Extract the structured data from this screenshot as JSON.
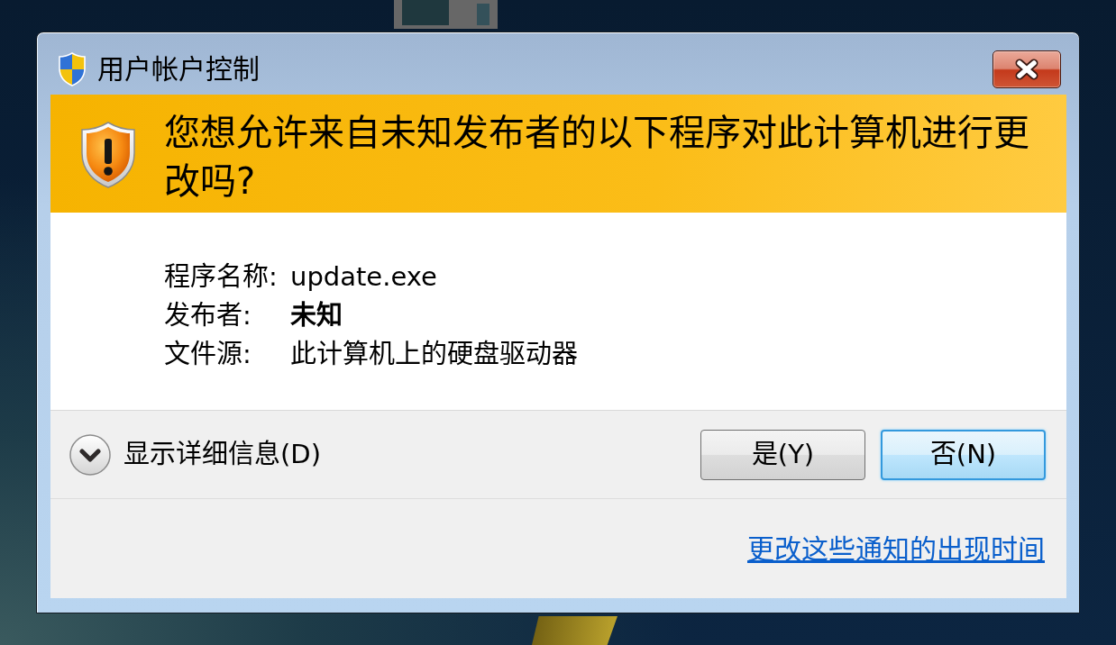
{
  "window": {
    "title": "用户帐户控制"
  },
  "header": {
    "question": "您想允许来自未知发布者的以下程序对此计算机进行更改吗?"
  },
  "details": [
    {
      "label": "程序名称:",
      "value": "update.exe",
      "bold": false
    },
    {
      "label": "发布者:",
      "value": "未知",
      "bold": true
    },
    {
      "label": "文件源:",
      "value": "此计算机上的硬盘驱动器",
      "bold": false
    }
  ],
  "details_toggle": {
    "label": "显示详细信息(D)",
    "expanded": false
  },
  "buttons": [
    {
      "label": "是(Y)",
      "focused": false
    },
    {
      "label": "否(N)",
      "focused": true
    }
  ],
  "link": "更改这些通知的出现时间"
}
